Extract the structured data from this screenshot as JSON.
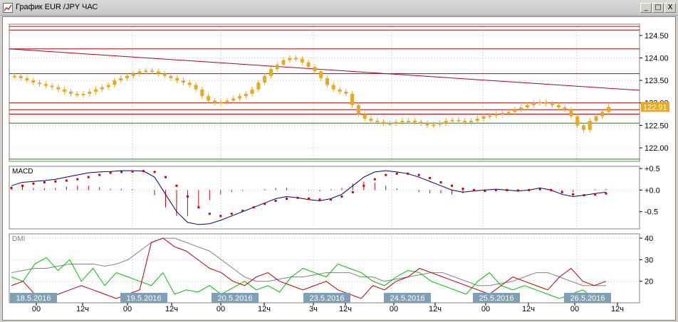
{
  "window": {
    "title": "График EUR /JPY ЧАС",
    "minimize_label": "_",
    "maximize_label": "□",
    "close_label": "X"
  },
  "colors": {
    "candle": "#e8a820",
    "resistance": "#c00000",
    "support": "#009000",
    "trend": "#b00020",
    "macd_line": "#000080",
    "macd_signal": "#d00000",
    "dmi_plus": "#00c000",
    "dmi_minus": "#c00000",
    "adx": "#808080",
    "current_price_bg": "#e8a820"
  },
  "price_panel": {
    "y_ticks": [
      "124.50",
      "124.00",
      "123.50",
      "123.00",
      "122.50",
      "122.00"
    ],
    "current_price": "122.91"
  },
  "macd_panel": {
    "label": "MACD",
    "y_ticks": [
      "+0.5",
      "+0.0",
      "-0.5"
    ]
  },
  "dmi_panel": {
    "label": "DMI",
    "y_ticks": [
      "40",
      "30",
      "20"
    ]
  },
  "time_axis": {
    "date_labels": [
      "18.5.2016",
      "19.5.2016",
      "20.5.2016",
      "23.5.2016",
      "24.5.2016",
      "25.5.2016",
      "26.5.2016"
    ],
    "hour_labels": [
      "00",
      "12ч",
      "00",
      "12ч",
      "00",
      "12ч",
      "3ч",
      "12ч",
      "00",
      "12ч",
      "00",
      "12ч",
      "00",
      "12ч"
    ]
  },
  "chart_data": {
    "type": "candlestick",
    "instrument": "EUR/JPY",
    "timeframe": "ЧАС",
    "price_ylim": [
      121.7,
      124.75
    ],
    "horizontal_levels_red": [
      124.7,
      124.62,
      124.2,
      123.65,
      123.0,
      122.85,
      122.75
    ],
    "horizontal_levels_green": [
      122.55,
      121.75
    ],
    "trendline": {
      "start": 124.2,
      "end": 123.28
    },
    "close_series": [
      123.6,
      123.55,
      123.5,
      123.45,
      123.42,
      123.38,
      123.35,
      123.3,
      123.25,
      123.2,
      123.18,
      123.2,
      123.25,
      123.3,
      123.35,
      123.4,
      123.5,
      123.55,
      123.6,
      123.65,
      123.7,
      123.72,
      123.7,
      123.65,
      123.6,
      123.55,
      123.5,
      123.45,
      123.4,
      123.3,
      123.15,
      123.05,
      123.0,
      123.02,
      123.05,
      123.1,
      123.15,
      123.2,
      123.3,
      123.45,
      123.6,
      123.75,
      123.85,
      123.95,
      124.0,
      123.98,
      123.9,
      123.8,
      123.7,
      123.55,
      123.4,
      123.3,
      123.25,
      123.2,
      122.95,
      122.75,
      122.65,
      122.6,
      122.58,
      122.55,
      122.55,
      122.58,
      122.6,
      122.6,
      122.58,
      122.55,
      122.5,
      122.52,
      122.55,
      122.6,
      122.62,
      122.6,
      122.58,
      122.6,
      122.65,
      122.7,
      122.72,
      122.75,
      122.78,
      122.8,
      122.85,
      122.9,
      122.95,
      123.0,
      123.02,
      122.98,
      122.95,
      122.9,
      122.85,
      122.7,
      122.5,
      122.4,
      122.6,
      122.7,
      122.8,
      122.91
    ],
    "macd_ylim": [
      -0.9,
      0.55
    ],
    "macd_series": [
      0.1,
      0.18,
      0.2,
      0.22,
      0.25,
      0.3,
      0.35,
      0.4,
      0.42,
      0.43,
      0.45,
      0.45,
      0.44,
      0.3,
      -0.1,
      -0.5,
      -0.75,
      -0.8,
      -0.78,
      -0.7,
      -0.6,
      -0.5,
      -0.4,
      -0.3,
      -0.2,
      -0.15,
      -0.18,
      -0.22,
      -0.25,
      -0.2,
      -0.1,
      0.1,
      0.3,
      0.42,
      0.45,
      0.42,
      0.38,
      0.3,
      0.2,
      0.1,
      0.0,
      -0.05,
      -0.02,
      0.0,
      0.02,
      0.0,
      -0.02,
      0.0,
      0.05,
      0.0,
      -0.1,
      -0.15,
      -0.12,
      -0.08,
      -0.05
    ],
    "macd_signal_series": [
      0.05,
      0.1,
      0.15,
      0.18,
      0.2,
      0.22,
      0.25,
      0.3,
      0.35,
      0.4,
      0.42,
      0.43,
      0.44,
      0.42,
      0.3,
      0.1,
      -0.15,
      -0.4,
      -0.55,
      -0.6,
      -0.55,
      -0.48,
      -0.4,
      -0.32,
      -0.25,
      -0.2,
      -0.18,
      -0.2,
      -0.22,
      -0.22,
      -0.15,
      -0.05,
      0.1,
      0.25,
      0.35,
      0.38,
      0.38,
      0.35,
      0.28,
      0.18,
      0.1,
      0.03,
      0.0,
      -0.02,
      0.0,
      0.0,
      -0.01,
      0.0,
      0.02,
      0.0,
      -0.05,
      -0.1,
      -0.12,
      -0.1,
      -0.08
    ],
    "dmi_ylim": [
      10,
      42
    ],
    "dmi_plus_series": [
      22,
      20,
      28,
      31,
      25,
      30,
      20,
      26,
      18,
      24,
      22,
      20,
      18,
      24,
      14,
      16,
      15,
      18,
      14,
      17,
      20,
      16,
      18,
      15,
      22,
      26,
      24,
      22,
      28,
      26,
      24,
      20,
      18,
      22,
      25,
      24,
      20,
      18,
      16,
      14,
      20,
      24,
      18,
      16,
      18,
      16,
      14,
      12,
      14,
      16,
      12,
      14
    ],
    "dmi_minus_series": [
      18,
      20,
      14,
      12,
      14,
      16,
      18,
      16,
      14,
      12,
      14,
      16,
      38,
      40,
      36,
      34,
      30,
      26,
      24,
      20,
      18,
      22,
      24,
      20,
      18,
      16,
      18,
      20,
      16,
      14,
      12,
      18,
      16,
      20,
      22,
      26,
      24,
      22,
      20,
      18,
      16,
      14,
      18,
      22,
      20,
      18,
      16,
      22,
      26,
      20,
      18,
      20
    ],
    "adx_series": [
      24,
      25,
      26,
      26,
      27,
      28,
      28,
      28,
      27,
      28,
      30,
      34,
      38,
      40,
      40,
      38,
      36,
      34,
      30,
      26,
      22,
      20,
      20,
      21,
      22,
      22,
      23,
      24,
      24,
      24,
      22,
      22,
      20,
      21,
      22,
      23,
      24,
      24,
      22,
      20,
      18,
      18,
      19,
      20,
      22,
      24,
      24,
      22,
      20,
      18,
      18,
      18
    ]
  }
}
